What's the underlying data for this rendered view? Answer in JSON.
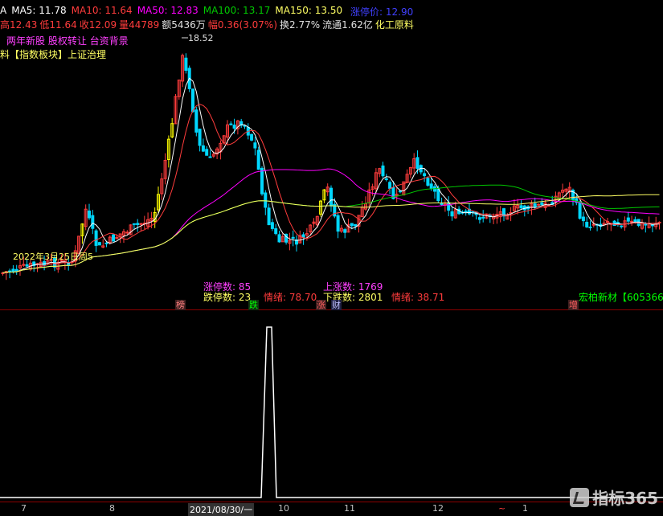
{
  "ma_line": {
    "ma5": "MA5: 11.78",
    "ma10": "MA10: 11.64",
    "ma50": "MA50: 12.83",
    "ma100": "MA100: 13.17",
    "ma150": "MA150: 13.50",
    "limit_up": "涨停价: 12.90",
    "left_mark": "A"
  },
  "quote_line": {
    "high": "高12.43",
    "low": "低11.64",
    "close": "收12.09",
    "volume": "量44789",
    "amount": "额5436万",
    "change": "幅0.36(3.07%)",
    "turnover": "换2.77%",
    "float": "流通1.62亿",
    "industry": "化工原料"
  },
  "concepts": "两年新股 股权转让 台资背景",
  "sector_line": "料【指数板块】上证治理",
  "peak_label": "18.52",
  "date_annotation": "2022年3月25日周5",
  "stats": {
    "limit_up_count": "涨停数: 85",
    "limit_down_count": "跌停数: 23",
    "mood1": "情绪: 78.70",
    "rise_count": "上涨数: 1769",
    "fall_count": "下跌数: 2801",
    "mood2": "情绪: 38.71"
  },
  "markers": [
    {
      "text": "榜",
      "color": "#ff8080"
    },
    {
      "text": "跌",
      "color": "#00ff00"
    },
    {
      "text": "涨",
      "color": "#ff6060"
    },
    {
      "text": "财",
      "color": "#c0c0ff"
    },
    {
      "text": "增",
      "color": "#ff6060"
    }
  ],
  "stock_tag": "宏柏新材【605366",
  "axis": {
    "ticks": [
      "7",
      "8",
      "2021/08/30/一",
      "10",
      "11",
      "12",
      "~",
      "1"
    ]
  },
  "logo_text": "指标365",
  "colors": {
    "up": "#ff3c3c",
    "down": "#00d7ff",
    "ma5": "#ffffff",
    "ma10": "#ff3c3c",
    "ma50": "#ff00ff",
    "ma100": "#00c800",
    "ma150": "#ffff64",
    "highlight": "#ffff00"
  }
}
